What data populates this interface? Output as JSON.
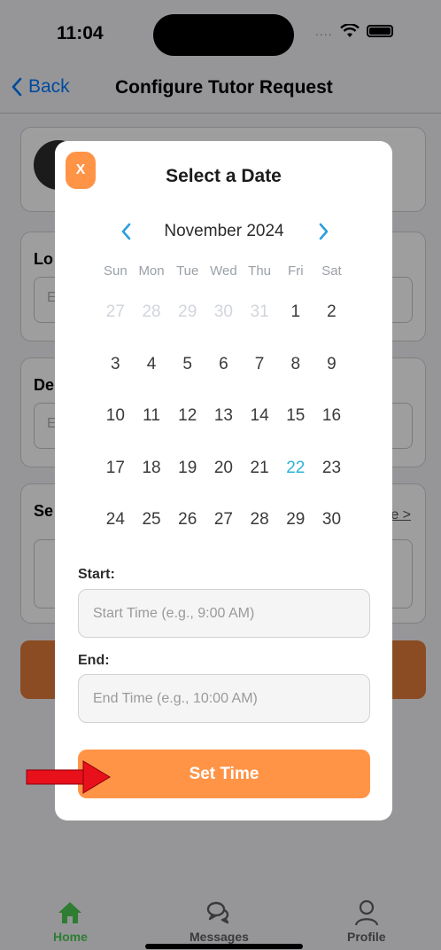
{
  "status": {
    "time": "11:04",
    "signal_dots": "...."
  },
  "nav": {
    "back_label": "Back",
    "title": "Configure Tutor Request"
  },
  "background": {
    "location_label": "Lo",
    "location_placeholder": "E",
    "description_label": "De",
    "description_placeholder": "E",
    "schedule_label": "Se",
    "schedule_link": "e >"
  },
  "modal": {
    "close_label": "X",
    "title": "Select a Date",
    "month_label": "November 2024",
    "weekdays": [
      "Sun",
      "Mon",
      "Tue",
      "Wed",
      "Thu",
      "Fri",
      "Sat"
    ],
    "weeks": [
      [
        "27",
        "28",
        "29",
        "30",
        "31",
        "1",
        "2"
      ],
      [
        "3",
        "4",
        "5",
        "6",
        "7",
        "8",
        "9"
      ],
      [
        "10",
        "11",
        "12",
        "13",
        "14",
        "15",
        "16"
      ],
      [
        "17",
        "18",
        "19",
        "20",
        "21",
        "22",
        "23"
      ],
      [
        "24",
        "25",
        "26",
        "27",
        "28",
        "29",
        "30"
      ]
    ],
    "selected_day": "22",
    "start_label": "Start:",
    "start_placeholder": "Start Time (e.g., 9:00 AM)",
    "end_label": "End:",
    "end_placeholder": "End Time (e.g., 10:00 AM)",
    "set_button": "Set Time"
  },
  "tabs": {
    "home": "Home",
    "messages": "Messages",
    "profile": "Profile"
  },
  "colors": {
    "accent_orange": "#ff9447",
    "selected_day": "#2bb3d6",
    "chevron_blue": "#2b9fe0",
    "home_green": "#2e7d32",
    "arrow_red": "#e8101a"
  }
}
